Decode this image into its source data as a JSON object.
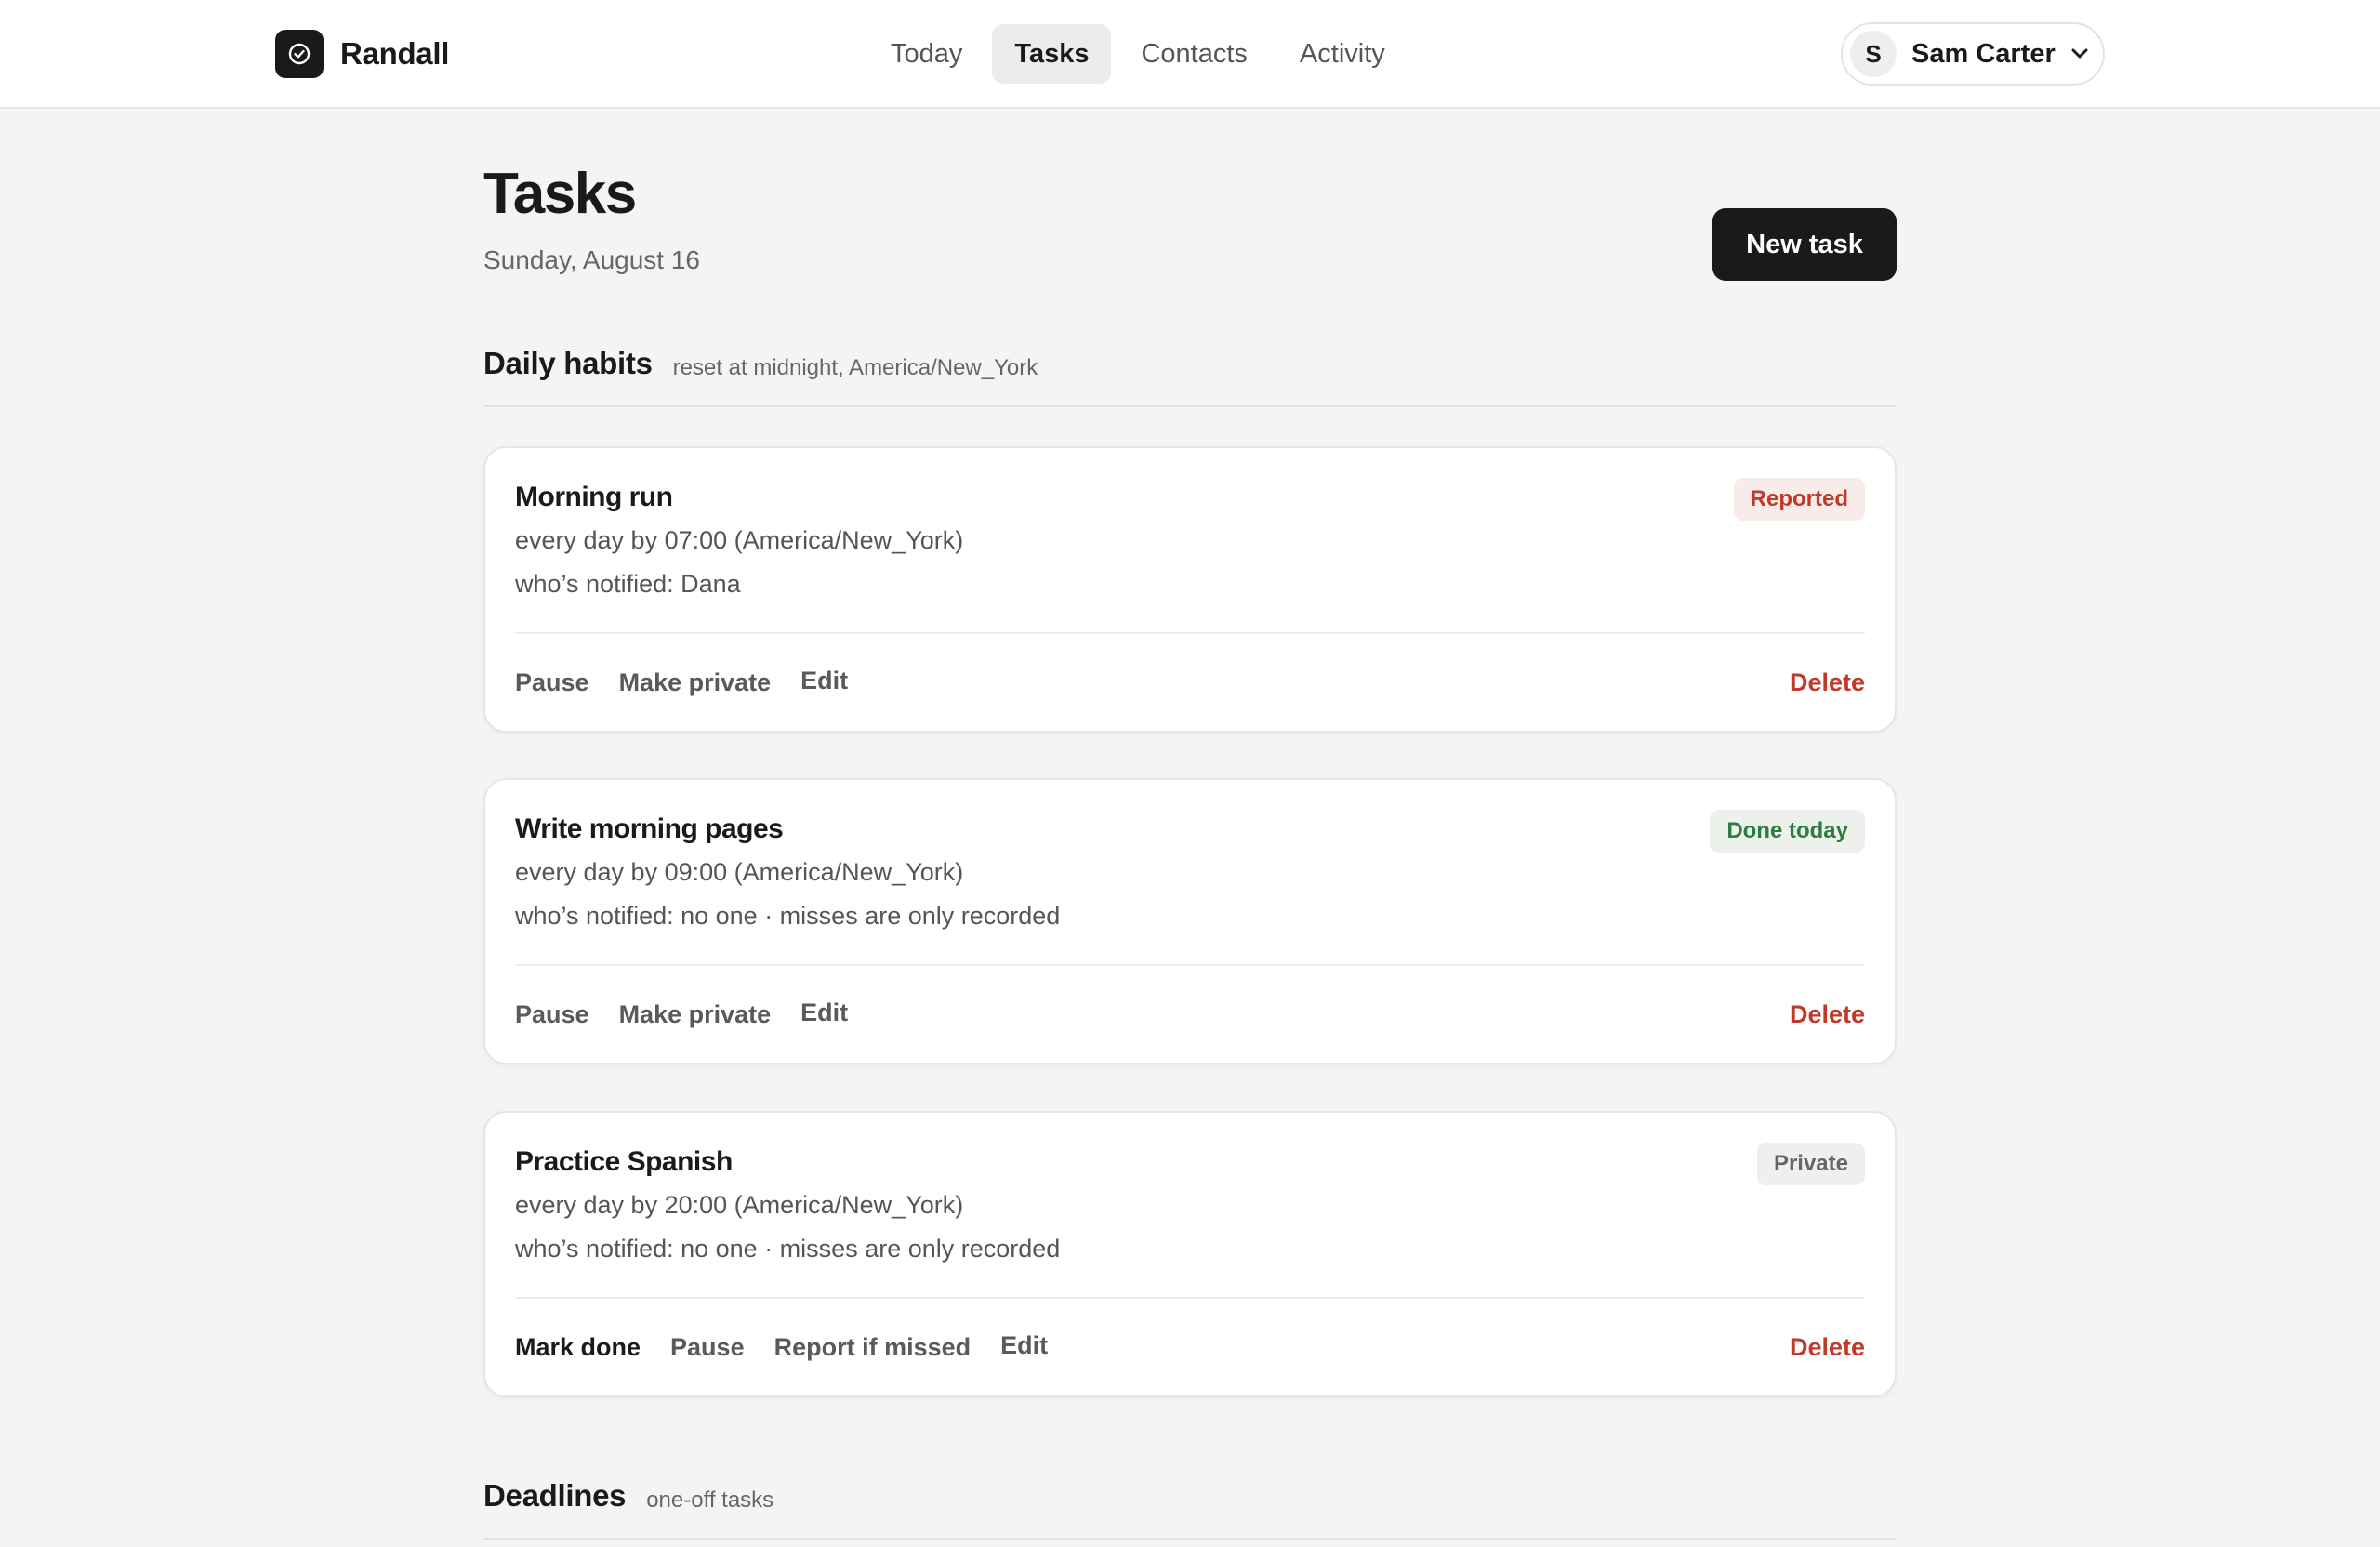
{
  "app": {
    "name": "Randall",
    "logo_icon": "check-circle-icon"
  },
  "nav": {
    "tabs": [
      {
        "label": "Today",
        "active": false
      },
      {
        "label": "Tasks",
        "active": true
      },
      {
        "label": "Contacts",
        "active": false
      },
      {
        "label": "Activity",
        "active": false
      }
    ]
  },
  "user": {
    "initial": "S",
    "name": "Sam Carter",
    "menu_icon": "chevron-down-icon"
  },
  "page": {
    "title": "Tasks",
    "date": "Sunday, August 16",
    "new_task_label": "New task"
  },
  "sections": {
    "daily": {
      "title": "Daily habits",
      "subtitle": "reset at midnight, America/New_York"
    },
    "deadlines": {
      "title": "Deadlines",
      "subtitle": "one-off tasks"
    }
  },
  "habits": [
    {
      "title": "Morning run",
      "schedule": "every day by 07:00 (America/New_York)",
      "notified": "who’s notified: Dana",
      "badge": "Reported",
      "badge_type": "reported",
      "actions": [
        "Pause",
        "Make private",
        "Edit"
      ],
      "delete_label": "Delete"
    },
    {
      "title": "Write morning pages",
      "schedule": "every day by 09:00 (America/New_York)",
      "notified": "who’s notified: no one · misses are only recorded",
      "badge": "Done today",
      "badge_type": "done",
      "actions": [
        "Pause",
        "Make private",
        "Edit"
      ],
      "delete_label": "Delete"
    },
    {
      "title": "Practice Spanish",
      "schedule": "every day by 20:00 (America/New_York)",
      "notified": "who’s notified: no one · misses are only recorded",
      "badge": "Private",
      "badge_type": "private",
      "actions": [
        "Mark done",
        "Pause",
        "Report if missed",
        "Edit"
      ],
      "delete_label": "Delete"
    }
  ],
  "colors": {
    "background": "#f4f4f2",
    "primary": "#1a1a1a",
    "danger": "#c0392b",
    "success": "#2e7d3e"
  }
}
